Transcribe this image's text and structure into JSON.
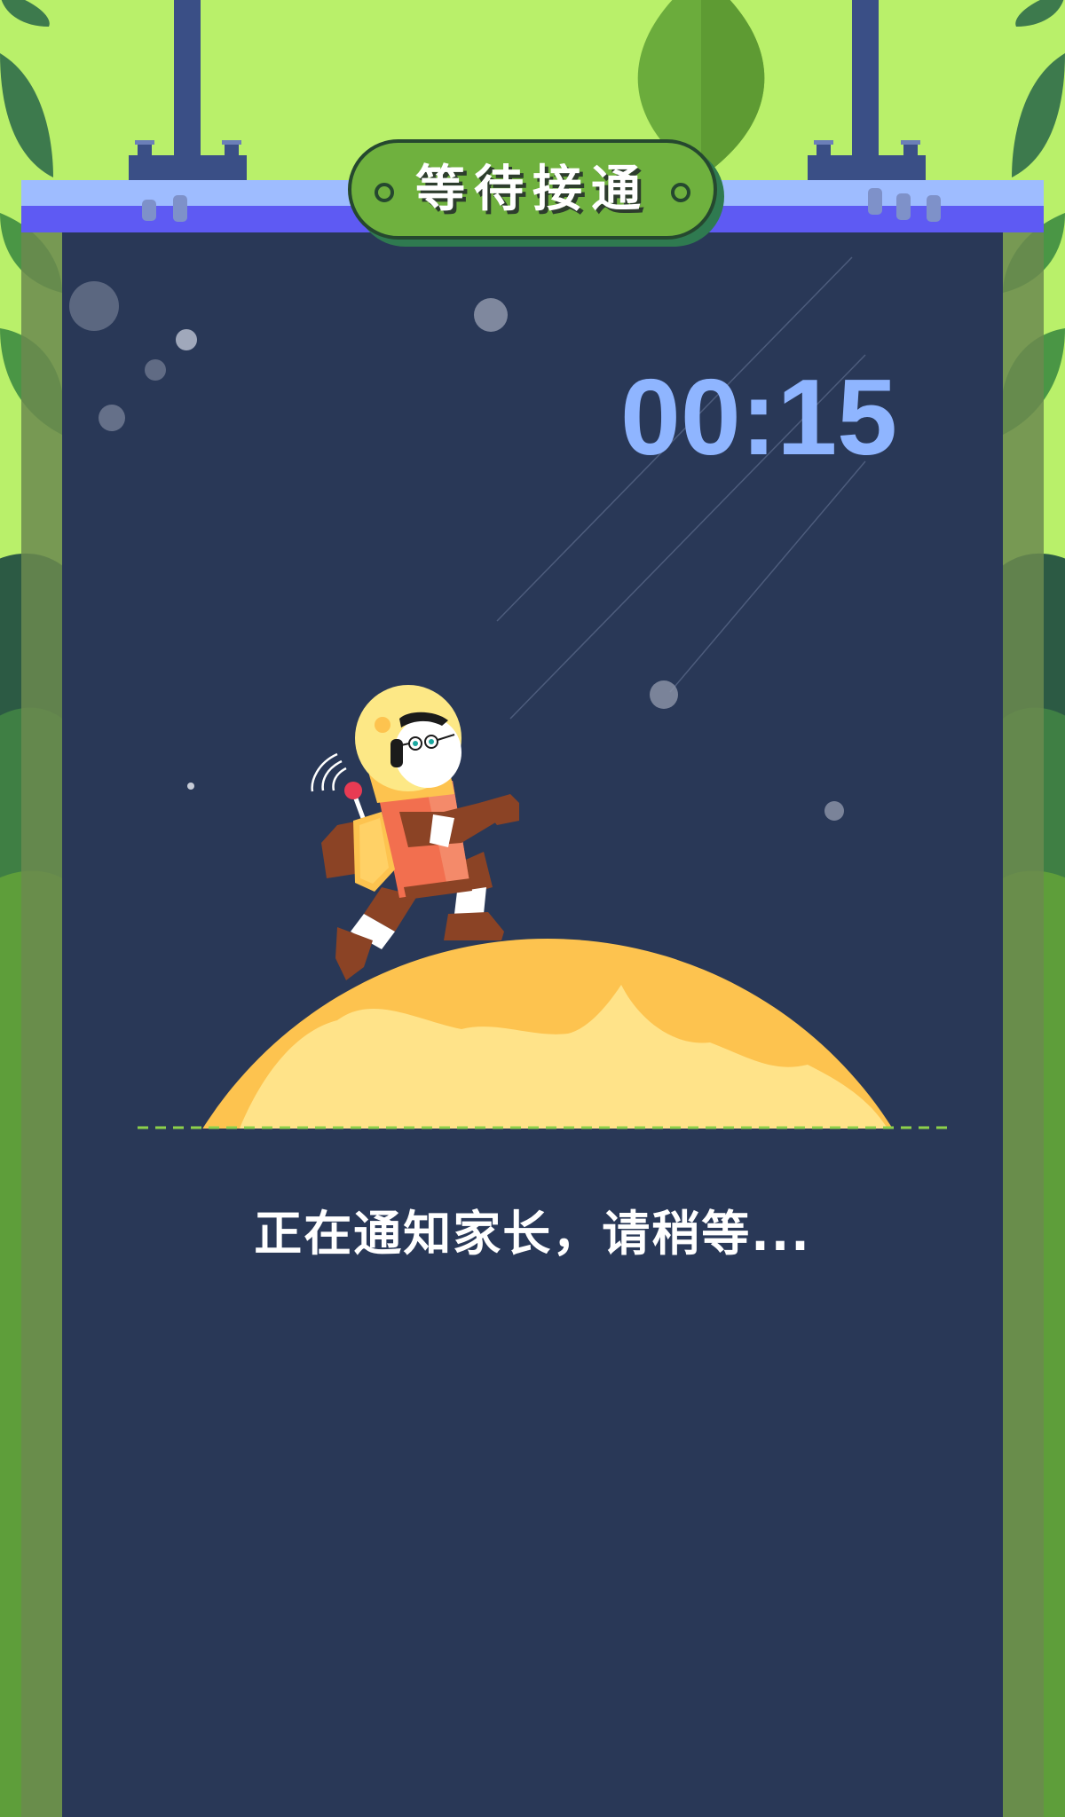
{
  "header": {
    "title": "等待接通"
  },
  "call": {
    "timer": "00:15",
    "status": "正在通知家长，请稍等..."
  },
  "colors": {
    "background_green": "#b9f06a",
    "panel_navy": "#293857",
    "rail_blue": "#5f5cf5",
    "pill_green": "#6fb13e",
    "timer_blue": "#8fb5ff",
    "planet_yellow": "#fdc34f"
  },
  "illustration": {
    "character": "astronaut-robot-icon",
    "planet": "planet-icon"
  }
}
